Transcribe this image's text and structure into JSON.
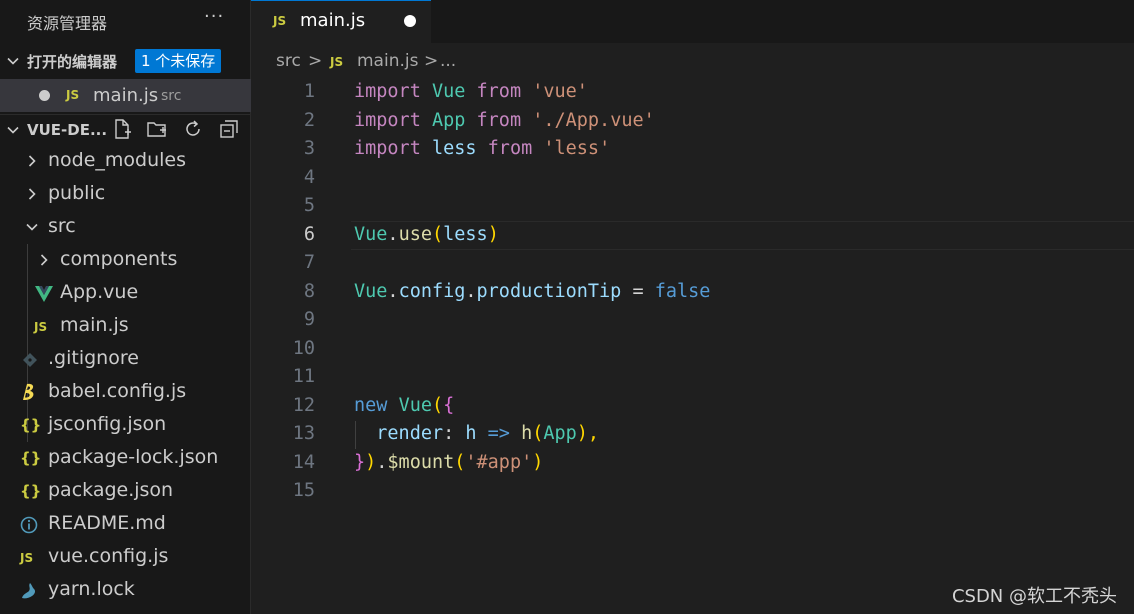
{
  "sidebar": {
    "title": "资源管理器",
    "more": "···",
    "open_editors": {
      "label": "打开的编辑器",
      "badge": "1 个未保存",
      "files": [
        {
          "icon": "JS",
          "name": "main.js",
          "dir": "src"
        }
      ]
    },
    "project": {
      "label": "VUE-DE...",
      "actions": [
        "new-file-icon",
        "new-folder-icon",
        "refresh-icon",
        "collapse-all-icon"
      ]
    },
    "tree": [
      {
        "name": "node_modules",
        "icon": "chevron-right-icon"
      },
      {
        "name": "public",
        "icon": "chevron-right-icon"
      },
      {
        "name": "src",
        "icon": "chevron-down-icon"
      },
      {
        "name": "components",
        "icon": "chevron-right-icon"
      },
      {
        "name": "App.vue",
        "icon": "vue-icon"
      },
      {
        "name": "main.js",
        "icon": "js-icon",
        "icon_text": "JS"
      },
      {
        "name": ".gitignore",
        "icon": "git-icon"
      },
      {
        "name": "babel.config.js",
        "icon": "babel-icon"
      },
      {
        "name": "jsconfig.json",
        "icon": "json-icon",
        "icon_text": "{}"
      },
      {
        "name": "package-lock.json",
        "icon": "json-icon",
        "icon_text": "{}"
      },
      {
        "name": "package.json",
        "icon": "json-icon",
        "icon_text": "{}"
      },
      {
        "name": "README.md",
        "icon": "info-icon"
      },
      {
        "name": "vue.config.js",
        "icon": "js-icon",
        "icon_text": "JS"
      },
      {
        "name": "yarn.lock",
        "icon": "yarn-icon"
      }
    ]
  },
  "editor": {
    "tab": {
      "icon": "JS",
      "name": "main.js"
    },
    "breadcrumb": {
      "folder": "src",
      "sep": ">",
      "icon": "JS",
      "file": "main.js",
      "more": "..."
    },
    "line_numbers": [
      "1",
      "2",
      "3",
      "4",
      "5",
      "6",
      "7",
      "8",
      "9",
      "10",
      "11",
      "12",
      "13",
      "14",
      "15"
    ],
    "active_line": "6",
    "code": {
      "l1": [
        "import",
        "Vue",
        "from",
        "'vue'"
      ],
      "l2": [
        "import",
        "App",
        "from",
        "'./App.vue'"
      ],
      "l3": [
        "import",
        "less",
        "from",
        "'less'"
      ],
      "l6": [
        "Vue",
        ".",
        "use",
        "(",
        "less",
        ")"
      ],
      "l8": [
        "Vue",
        ".",
        "config",
        ".",
        "productionTip",
        " = ",
        "false"
      ],
      "l12": [
        "new",
        "Vue",
        "(",
        "{"
      ],
      "l13": [
        "render",
        ": ",
        "h",
        " => ",
        "h",
        "(",
        "App",
        "),"
      ],
      "l14": [
        "}",
        ")",
        ".",
        "$mount",
        "(",
        "'#app'",
        ")"
      ]
    }
  },
  "watermark": "CSDN @软工不秃头",
  "colors": {
    "accent": "#0078d4",
    "keyword": "#c586c0",
    "class": "#4ec9b0",
    "string": "#ce9178",
    "function": "#dcdcaa",
    "variable": "#9cdcfe",
    "literal": "#569cd6",
    "js_icon": "#cbcb41"
  }
}
